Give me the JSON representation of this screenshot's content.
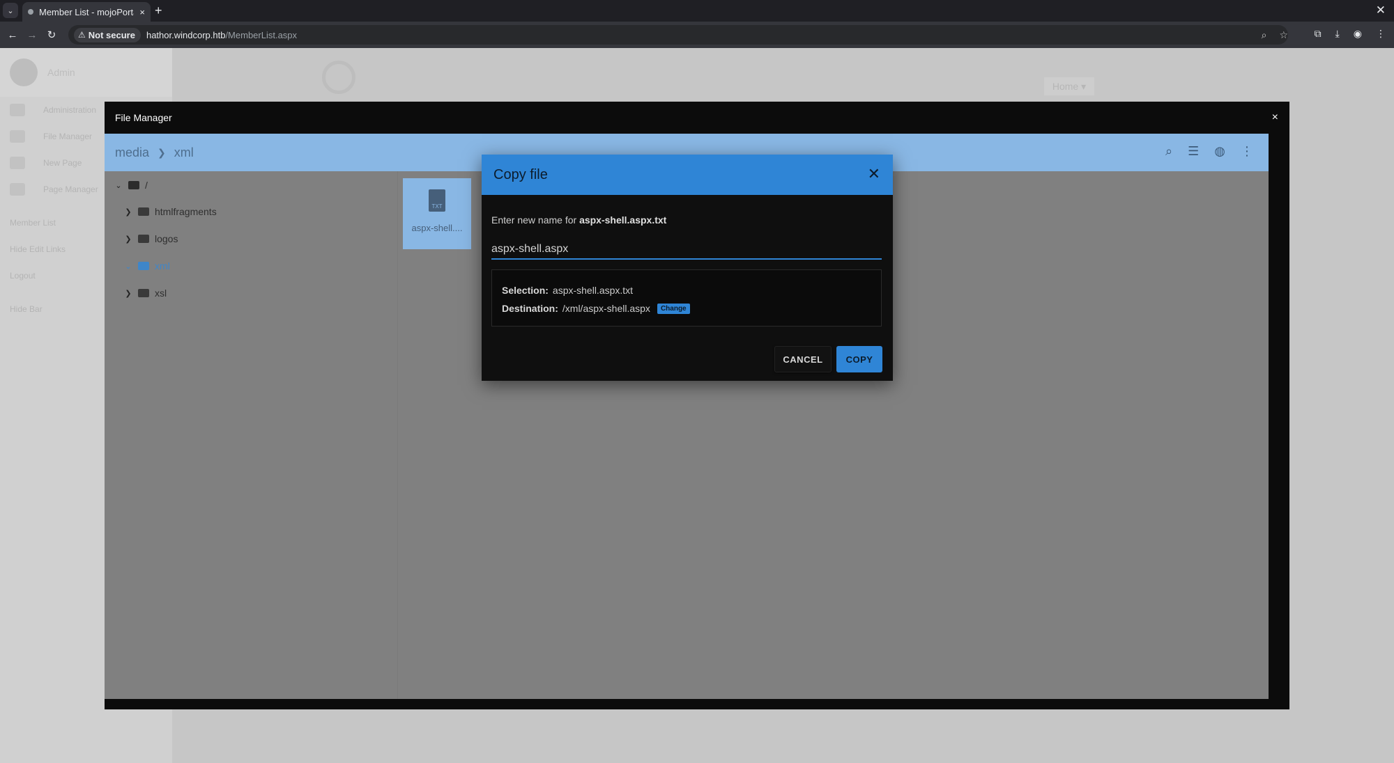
{
  "browser": {
    "tab_title": "Member List - mojoPortal",
    "tab_close": "×",
    "new_tab": "+",
    "window_close": "✕",
    "security_label": "Not secure",
    "url_host": "hathor.windcorp.htb",
    "url_path": "/MemberList.aspx"
  },
  "page": {
    "sidebar": {
      "user_name": "Admin",
      "items": [
        "Administration",
        "File Manager",
        "New Page",
        "Page Manager"
      ],
      "links": [
        "Member List",
        "Hide Edit Links",
        "Logout",
        "Hide Bar"
      ]
    },
    "nav_home": "Home ▾"
  },
  "file_manager": {
    "title": "File Manager",
    "close": "×",
    "breadcrumb": [
      "media",
      "xml"
    ],
    "tree": {
      "root": "/",
      "folders": [
        "htmlfragments",
        "logos",
        "xml",
        "xsl"
      ],
      "active_folder": "xml"
    },
    "file": {
      "name": "aspx-shell....",
      "ext": "TXT"
    }
  },
  "copy_dialog": {
    "title": "Copy file",
    "prompt_prefix": "Enter new name for",
    "prompt_file": "aspx-shell.aspx.txt",
    "new_name_value": "aspx-shell.aspx",
    "selection_label": "Selection:",
    "selection_value": "aspx-shell.aspx.txt",
    "destination_label": "Destination:",
    "destination_value": "/xml/aspx-shell.aspx",
    "change_label": "Change",
    "cancel_label": "CANCEL",
    "copy_label": "COPY"
  },
  "colors": {
    "accent": "#2f85d6",
    "toolbar_blue": "#89b7e4"
  }
}
